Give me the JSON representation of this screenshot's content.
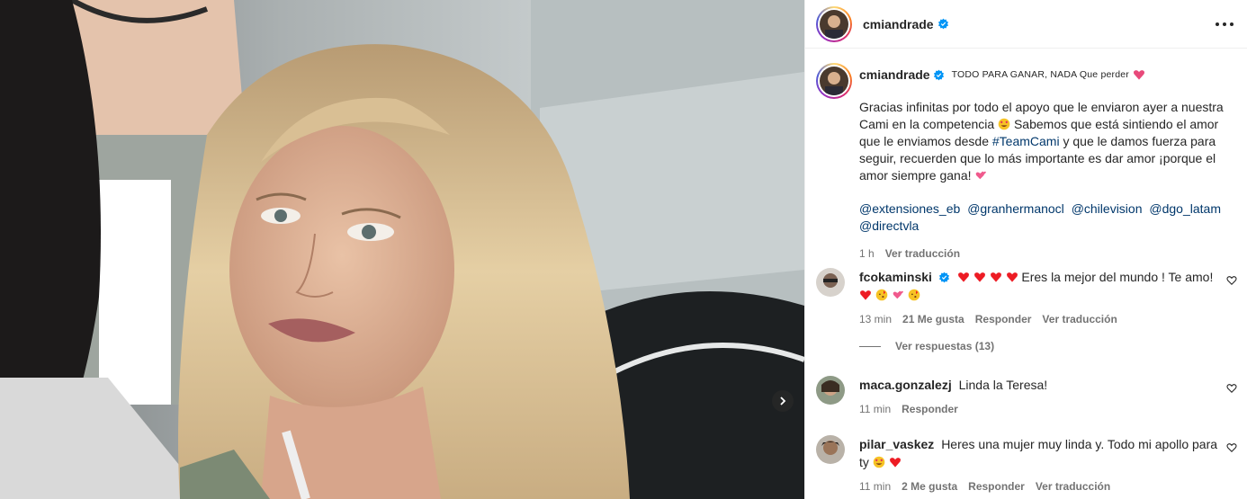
{
  "post": {
    "username": "cmiandrade",
    "caption_tagline": "TODO PARA GANAR, NADA Que perder",
    "caption_text_1": "Gracias infinitas por todo el apoyo que le enviaron ayer a nuestra Cami en la competencia",
    "caption_text_2": "Sabemos que está sintiendo el amor que le enviamos desde",
    "caption_hashtag": "#TeamCami",
    "caption_text_3": "y que le damos fuerza para seguir, recuerden que lo más importante es dar amor ¡porque el amor siempre gana!",
    "mentions": [
      "@extensiones_eb",
      "@granhermanocl",
      "@chilevision",
      "@dgo_latam",
      "@directvla"
    ],
    "time": "1 h",
    "translate": "Ver traducción"
  },
  "comments": [
    {
      "username": "fcokaminski",
      "text": "Eres la mejor del mundo ! Te amo!",
      "time": "13 min",
      "likes": "21 Me gusta",
      "reply": "Responder",
      "translate": "Ver traducción",
      "view_replies": "Ver respuestas (13)"
    },
    {
      "username": "maca.gonzalezj",
      "text": "Linda la Teresa!",
      "time": "11 min",
      "reply": "Responder"
    },
    {
      "username": "pilar_vaskez",
      "text": "Heres una mujer muy linda y. Todo mi apollo para ty",
      "time": "11 min",
      "likes": "2 Me gusta",
      "reply": "Responder",
      "translate": "Ver traducción"
    }
  ],
  "icons": {
    "verified": "verified-badge-icon",
    "more": "more-options-icon",
    "like": "heart-outline-icon",
    "next": "chevron-right-icon"
  },
  "colors": {
    "link": "#00376b",
    "verified": "#0095f6",
    "muted": "#737373",
    "heart_red": "#ed1c24"
  }
}
